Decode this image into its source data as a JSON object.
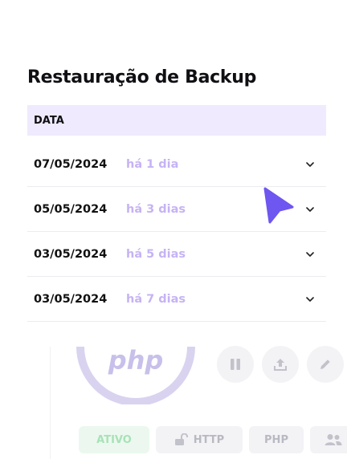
{
  "panel": {
    "title": "Restauração de Backup"
  },
  "table": {
    "header": "DATA",
    "rows": [
      {
        "date": "07/05/2024",
        "ago": "há 1 dia"
      },
      {
        "date": "05/05/2024",
        "ago": "há 3 dias"
      },
      {
        "date": "03/05/2024",
        "ago": "há 5 dias"
      },
      {
        "date": "03/05/2024",
        "ago": "há 7 dias"
      }
    ]
  },
  "background_card": {
    "logo_text": "php",
    "actions": [
      "pause-icon",
      "upload-icon",
      "pencil-icon"
    ],
    "tags": {
      "status": "ATIVO",
      "protocol": "HTTP",
      "language": "PHP"
    }
  },
  "colors": {
    "accent": "#6e56f0",
    "header_bg": "#efeafd",
    "ago_text": "#c6b3f4"
  }
}
